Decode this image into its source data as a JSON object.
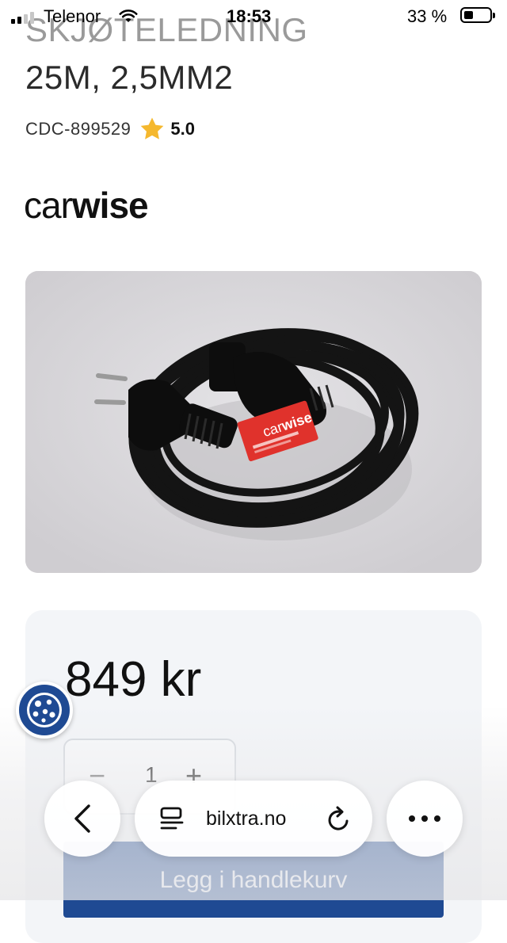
{
  "status_bar": {
    "carrier": "Telenor",
    "time": "18:53",
    "battery_percent": "33 %",
    "battery_level": 0.33,
    "icons": [
      "signal-icon",
      "wifi-icon",
      "battery-icon"
    ]
  },
  "product": {
    "title_line_1": "SKJØTELEDNING",
    "title_line_2": "25M, 2,5MM2",
    "sku": "CDC-899529",
    "rating": "5.0",
    "brand_light": "car",
    "brand_bold": "wise",
    "price": "849 kr",
    "quantity": "1",
    "qty_minus_label": "−",
    "qty_plus_label": "+",
    "add_to_cart_label": "Legg i handlekurv"
  },
  "browser": {
    "url": "bilxtra.no",
    "icons": [
      "back-chevron-icon",
      "reader-icon",
      "reload-icon",
      "more-icon"
    ]
  },
  "colors": {
    "accent": "#1f4a93",
    "star": "#f5b82e",
    "card_bg": "#f3f5f8",
    "label_red": "#e0322c"
  }
}
